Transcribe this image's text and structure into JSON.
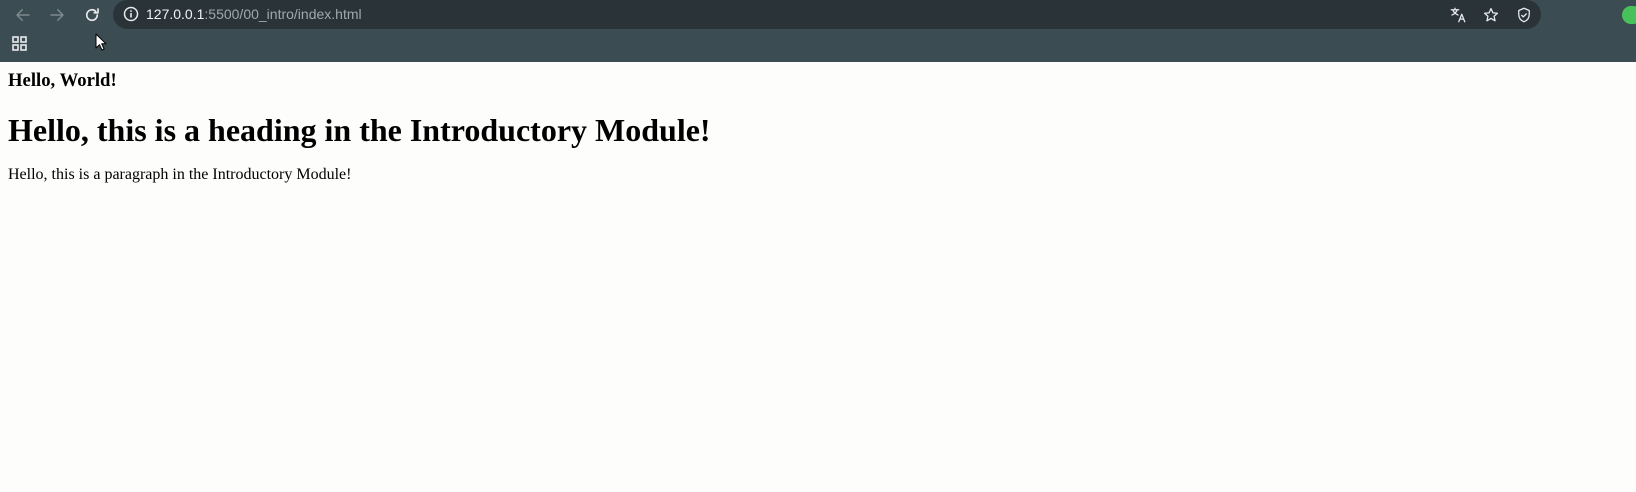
{
  "browser": {
    "url_host": "127.0.0.1",
    "url_rest": ":5500/00_intro/index.html",
    "frame_color": "#3b4c52",
    "omnibox_color": "#2a3438",
    "profile_color": "#49c15a",
    "icons": {
      "back": "arrow-left-icon",
      "forward": "arrow-right-icon",
      "reload": "reload-icon",
      "site_info": "info-icon",
      "translate": "translate-icon",
      "bookmark": "star-icon",
      "extension": "shield-icon",
      "apps": "apps-grid-icon"
    }
  },
  "page": {
    "heading_small": "Hello, World!",
    "heading_main": "Hello, this is a heading in the Introductory Module!",
    "paragraph": "Hello, this is a paragraph in the Introductory Module!"
  }
}
